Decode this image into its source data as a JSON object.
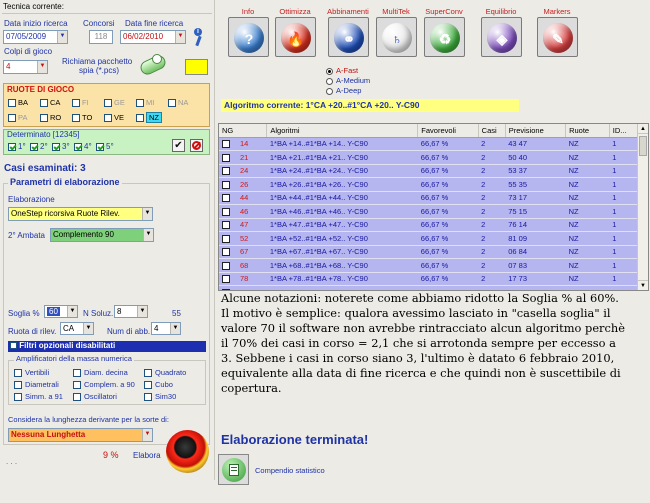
{
  "left": {
    "section_title": "Tecnica corrente:",
    "date_start_label": "Data inizio ricerca",
    "date_start_value": "07/05/2009",
    "concorsi_label": "Concorsi",
    "concorsi_value": "118",
    "date_end_label": "Data fine ricerca",
    "date_end_value": "06/02/2010",
    "colpi_label": "Colpi di gioco",
    "colpi_value": "4",
    "richiama_label_1": "Richiama pacchetto",
    "richiama_label_2": "spia (*.pcs)",
    "ruote_title": "RUOTE DI GIOCO",
    "ruote": [
      "BA",
      "CA",
      "FI",
      "GE",
      "MI",
      "NA",
      "PA",
      "RO",
      "TO",
      "VE",
      "NZ"
    ],
    "determinato_label": "Determinato [12345]",
    "determinato": [
      "1°",
      "2°",
      "3°",
      "4°",
      "5°"
    ],
    "casi_esaminati": "Casi esaminati: 3",
    "params_title": "Parametri di elaborazione",
    "elaborazione_label": "Elaborazione",
    "elaborazione_value": "OneStep ricorsiva Ruote Rilev.",
    "ambata_label": "2° Ambata",
    "ambata_value": "Complemento 90",
    "soglia_label": "Soglia %",
    "soglia_value": "60",
    "nsoluz_label": "N Soluz.",
    "nsoluz_value": "8",
    "nsoluz_count": "55",
    "ruota_rilev_label": "Ruota di rilev.",
    "ruota_rilev_value": "CA",
    "num_abb_label": "Num di abb.",
    "num_abb_value": "4",
    "filtri_label": "Filtri opzionali disabilitati",
    "amplificatori_title": "Amplificatori della massa numerica",
    "amplificatori": [
      "Vertibili",
      "Diam. decina",
      "Quadrato",
      "Diametrali",
      "Complem. a 90",
      "Cubo",
      "Simm. a 91",
      "Oscillatori",
      "Sim30"
    ],
    "lunghezza_label": "Considera la lunghezza derivante per la sorte di:",
    "lunghezza_value": "Nessuna Lunghetta",
    "dots": ". . .",
    "progress": "9 %",
    "elabora_label": "Elabora"
  },
  "toolbar": {
    "buttons": [
      {
        "label": "Info",
        "icon": "question-icon",
        "color": "#3a7fd0",
        "glyph": "?"
      },
      {
        "label": "Ottimizza",
        "icon": "flame-icon",
        "color": "#d83020",
        "glyph": "🔥"
      },
      {
        "label": "Abbinamenti",
        "icon": "globe-icon",
        "color": "#1f4fb8",
        "glyph": "⚭"
      },
      {
        "label": "MultiTek",
        "icon": "saturn-icon",
        "color": "#e8e8e8",
        "glyph": "♄"
      },
      {
        "label": "SuperConv",
        "icon": "recycle-icon",
        "color": "#40b040",
        "glyph": "♻"
      },
      {
        "label": "Equilibrio",
        "icon": "stack-icon",
        "color": "#8050c0",
        "glyph": "◈"
      },
      {
        "label": "Markers",
        "icon": "marker-icon",
        "color": "#d84040",
        "glyph": "✎"
      }
    ],
    "modes": [
      "A-Fast",
      "A-Medium",
      "A-Deep"
    ],
    "algoritmo_corrente": "Algoritmo corrente: 1°CA +20..#1°CA +20.. Y-C90"
  },
  "table": {
    "headers": [
      "NG",
      "Algoritmi",
      "Favorevoli",
      "Casi",
      "Previsione",
      "Ruote",
      "ID..."
    ],
    "rows": [
      {
        "ng": "14",
        "alg": "1*BA +14..#1*BA +14.. Y-C90",
        "fav": "66,67 %",
        "casi": "2",
        "prev": "43 47",
        "ruote": "NZ",
        "id": "1"
      },
      {
        "ng": "21",
        "alg": "1*BA +21..#1*BA +21.. Y-C90",
        "fav": "66,67 %",
        "casi": "2",
        "prev": "50 40",
        "ruote": "NZ",
        "id": "1"
      },
      {
        "ng": "24",
        "alg": "1*BA +24..#1*BA +24.. Y-C90",
        "fav": "66,67 %",
        "casi": "2",
        "prev": "53 37",
        "ruote": "NZ",
        "id": "1"
      },
      {
        "ng": "26",
        "alg": "1*BA +26..#1*BA +26.. Y-C90",
        "fav": "66,67 %",
        "casi": "2",
        "prev": "55 35",
        "ruote": "NZ",
        "id": "1"
      },
      {
        "ng": "44",
        "alg": "1*BA +44..#1*BA +44.. Y-C90",
        "fav": "66,67 %",
        "casi": "2",
        "prev": "73 17",
        "ruote": "NZ",
        "id": "1"
      },
      {
        "ng": "46",
        "alg": "1*BA +46..#1*BA +46.. Y-C90",
        "fav": "66,67 %",
        "casi": "2",
        "prev": "75 15",
        "ruote": "NZ",
        "id": "1"
      },
      {
        "ng": "47",
        "alg": "1*BA +47..#1*BA +47.. Y-C90",
        "fav": "66,67 %",
        "casi": "2",
        "prev": "76 14",
        "ruote": "NZ",
        "id": "1"
      },
      {
        "ng": "52",
        "alg": "1*BA +52..#1*BA +52.. Y-C90",
        "fav": "66,67 %",
        "casi": "2",
        "prev": "81 09",
        "ruote": "NZ",
        "id": "1"
      },
      {
        "ng": "67",
        "alg": "1*BA +67..#1*BA +67.. Y-C90",
        "fav": "66,67 %",
        "casi": "2",
        "prev": "06 84",
        "ruote": "NZ",
        "id": "1"
      },
      {
        "ng": "68",
        "alg": "1*BA +68..#1*BA +68.. Y-C90",
        "fav": "66,67 %",
        "casi": "2",
        "prev": "07 83",
        "ruote": "NZ",
        "id": "1"
      },
      {
        "ng": "78",
        "alg": "1*BA +78..#1*BA +78.. Y-C90",
        "fav": "66,67 %",
        "casi": "2",
        "prev": "17 73",
        "ruote": "NZ",
        "id": "1"
      },
      {
        "ng": "79",
        "alg": "1*BA +79..#1*BA +79.. Y-C90",
        "fav": "66,67 %",
        "casi": "2",
        "prev": "18 72",
        "ruote": "NZ",
        "id": "1"
      }
    ]
  },
  "note": "Alcune notazioni: noterete come abbiamo ridotto la Soglia % al 60%. Il motivo è semplice: qualora avessimo lasciato in \"casella soglia\" il valore 70 il software non avrebbe rintracciato alcun algoritmo perchè il 70% dei casi in corso = 2,1 che si arrotonda sempre per eccesso a 3. Sebbene i casi in corso siano 3, l'ultimo è datato 6 febbraio 2010, equivalente alla data di fine ricerca e che quindi non è suscettibile di copertura.",
  "status": "Elaborazione terminata!",
  "compendio_label": "Compendio statistico"
}
